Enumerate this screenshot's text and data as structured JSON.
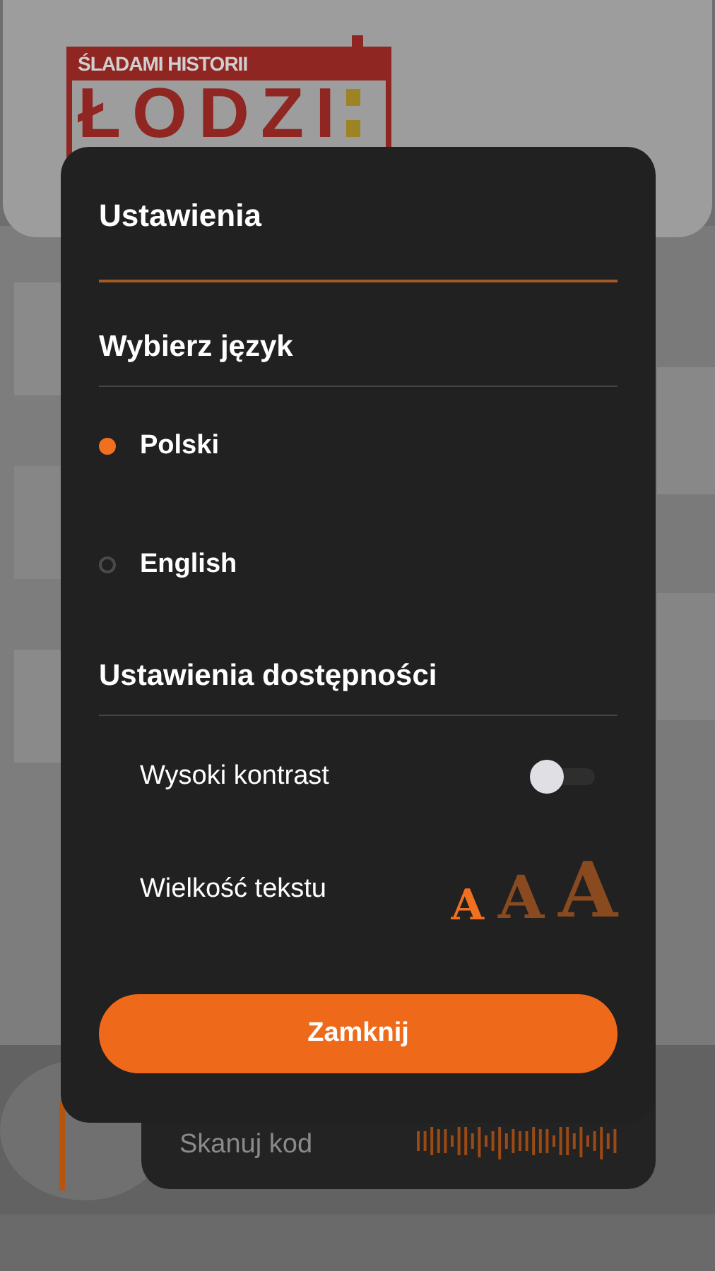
{
  "header": {
    "logo": {
      "top": "ŚLADAMI HISTORII",
      "main": "ŁODZI"
    }
  },
  "scan_card": {
    "label": "Skanuj kod"
  },
  "dialog": {
    "title": "Ustawienia",
    "language_heading": "Wybierz język",
    "languages": [
      {
        "label": "Polski",
        "selected": true
      },
      {
        "label": "English",
        "selected": false
      }
    ],
    "accessibility_heading": "Ustawienia dostępności",
    "high_contrast": {
      "label": "Wysoki kontrast",
      "on": false
    },
    "text_size": {
      "label": "Wielkość tekstu",
      "options": [
        {
          "label": "A",
          "selected": true
        },
        {
          "label": "A",
          "selected": false
        },
        {
          "label": "A",
          "selected": false
        }
      ]
    },
    "close_button": "Zamknij"
  }
}
